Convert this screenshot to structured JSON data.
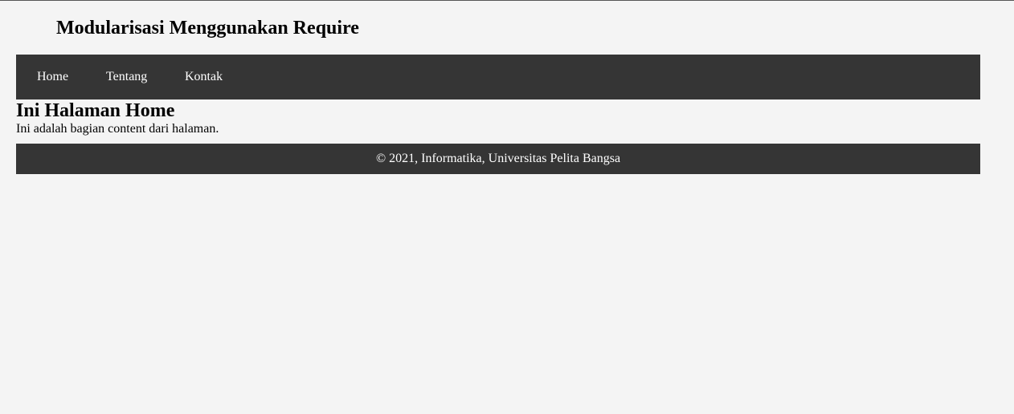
{
  "header": {
    "title": "Modularisasi Menggunakan Require"
  },
  "nav": {
    "items": [
      {
        "label": "Home"
      },
      {
        "label": "Tentang"
      },
      {
        "label": "Kontak"
      }
    ]
  },
  "content": {
    "heading": "Ini Halaman Home",
    "body": "Ini adalah bagian content dari halaman."
  },
  "footer": {
    "text": "© 2021, Informatika, Universitas Pelita Bangsa"
  },
  "colors": {
    "background": "#f4f4f4",
    "bar": "#353535",
    "bar_text": "#ffffff"
  }
}
